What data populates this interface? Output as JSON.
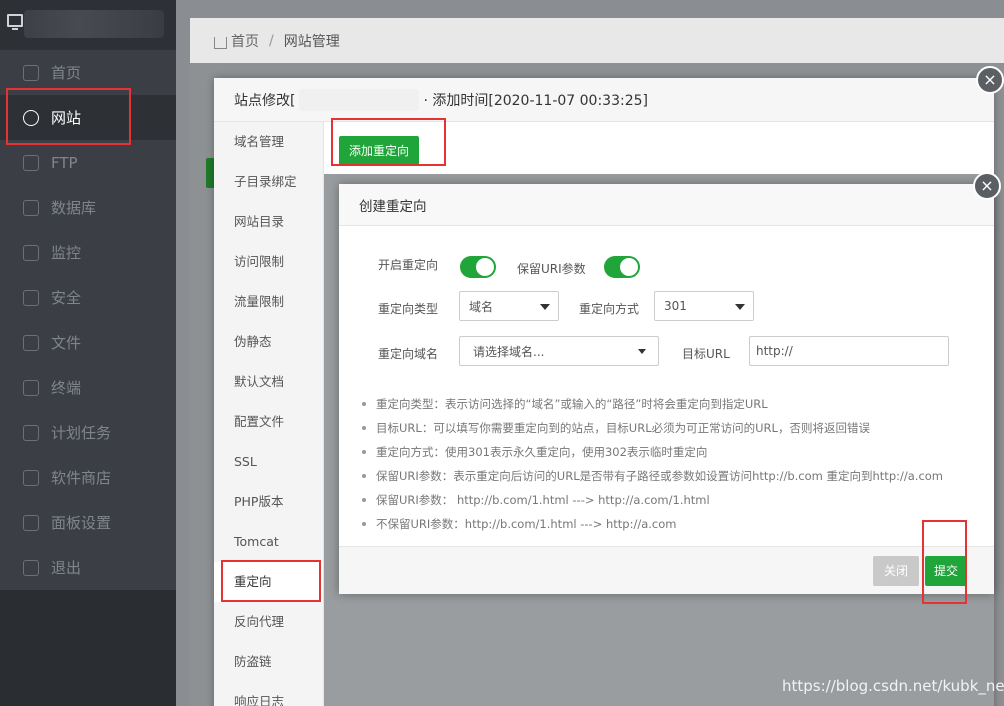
{
  "sidebar": {
    "items": [
      {
        "label": "首页",
        "icon": "home-icon"
      },
      {
        "label": "网站",
        "icon": "globe-icon"
      },
      {
        "label": "FTP",
        "icon": "ftp-icon"
      },
      {
        "label": "数据库",
        "icon": "database-icon"
      },
      {
        "label": "监控",
        "icon": "monitor-icon"
      },
      {
        "label": "安全",
        "icon": "shield-icon"
      },
      {
        "label": "文件",
        "icon": "folder-icon"
      },
      {
        "label": "终端",
        "icon": "terminal-icon"
      },
      {
        "label": "计划任务",
        "icon": "calendar-icon"
      },
      {
        "label": "软件商店",
        "icon": "grid-icon"
      },
      {
        "label": "面板设置",
        "icon": "settings-icon"
      },
      {
        "label": "退出",
        "icon": "logout-icon"
      }
    ],
    "active_index": 1
  },
  "breadcrumb": {
    "home": "首页",
    "separator": "/",
    "current": "网站管理"
  },
  "site_dialog": {
    "title_prefix": "站点修改[",
    "title_suffix": "· 添加时间[2020-11-07 00:33:25]",
    "close_symbol": "×",
    "tabs": [
      "域名管理",
      "子目录绑定",
      "网站目录",
      "访问限制",
      "流量限制",
      "伪静态",
      "默认文档",
      "配置文件",
      "SSL",
      "PHP版本",
      "Tomcat",
      "重定向",
      "反向代理",
      "防盗链",
      "响应日志"
    ],
    "active_tab": "重定向",
    "add_button": "添加重定向"
  },
  "redirect_dialog": {
    "title": "创建重定向",
    "close_symbol": "×",
    "enable_label": "开启重定向",
    "enable_on": true,
    "keep_uri_label": "保留URI参数",
    "keep_uri_on": true,
    "type_label": "重定向类型",
    "type_value": "域名",
    "mode_label": "重定向方式",
    "mode_value": "301",
    "domain_label": "重定向域名",
    "domain_placeholder": "请选择域名...",
    "target_label": "目标URL",
    "target_value": "http://",
    "tips": [
      "重定向类型：表示访问选择的“域名”或输入的“路径”时将会重定向到指定URL",
      "目标URL：可以填写你需要重定向到的站点，目标URL必须为可正常访问的URL，否则将返回错误",
      "重定向方式：使用301表示永久重定向，使用302表示临时重定向",
      "保留URI参数：表示重定向后访问的URL是否带有子路径或参数如设置访问http://b.com 重定向到http://a.com",
      "保留URI参数： http://b.com/1.html ---> http://a.com/1.html",
      "不保留URI参数：http://b.com/1.html ---> http://a.com"
    ],
    "close_button": "关闭",
    "submit_button": "提交"
  },
  "watermark": "https://blog.csdn.net/kubk_net",
  "colors": {
    "accent": "#20a53a",
    "annotation": "#e53333",
    "sidebar_bg": "#3b3f45"
  }
}
